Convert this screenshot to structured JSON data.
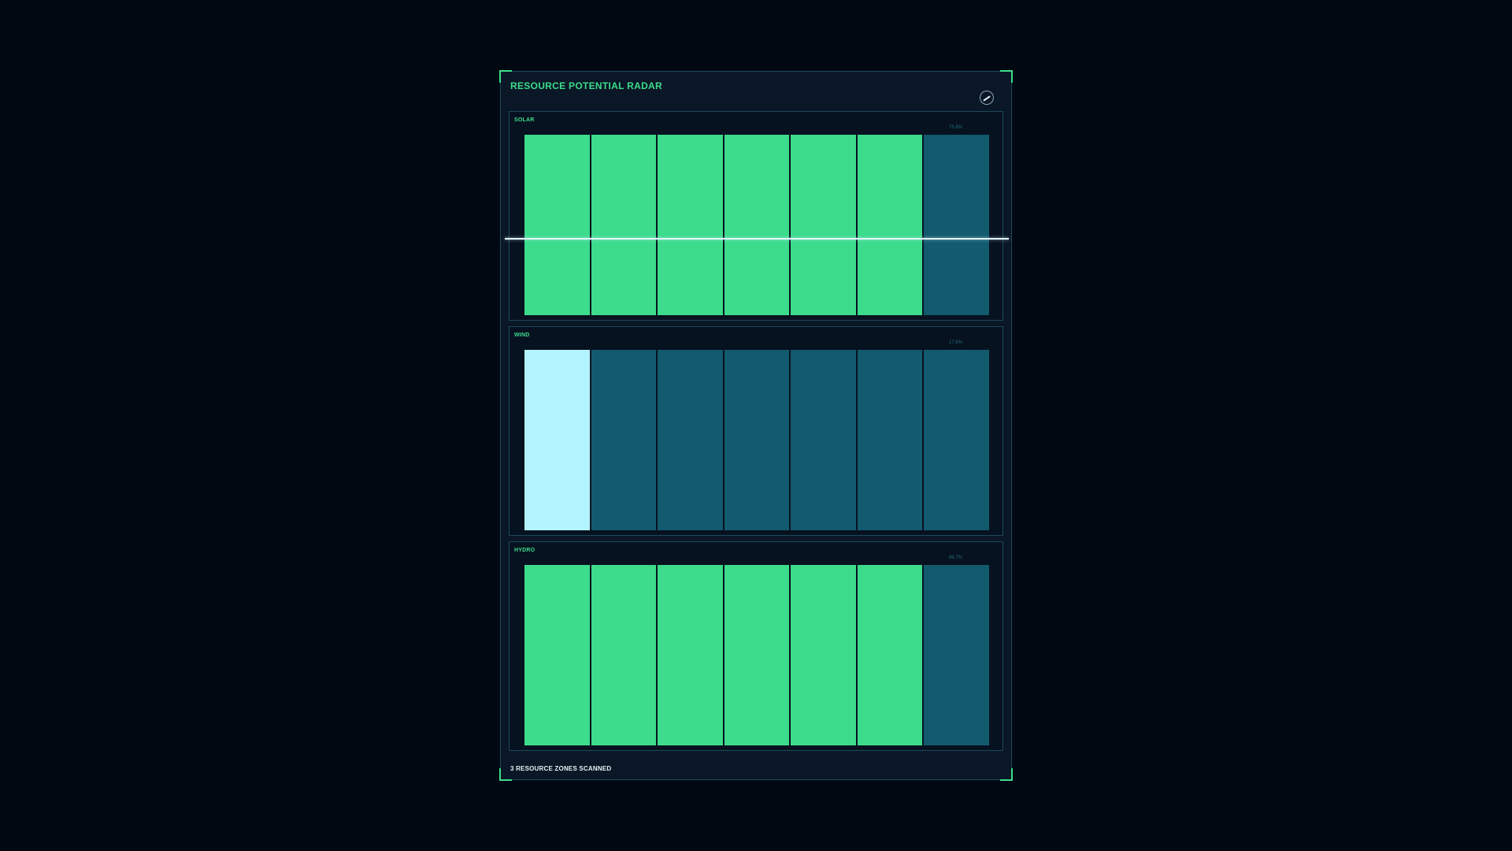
{
  "panel": {
    "title": "RESOURCE POTENTIAL RADAR",
    "footer": "3 RESOURCE ZONES SCANNED",
    "gauge_icon": "gauge-icon"
  },
  "colors": {
    "accent": "#3ddc8c",
    "active": "#3ddc8c",
    "inactive": "#125a6e",
    "highlight": "#b3f3ff"
  },
  "zones": [
    {
      "label": "SOLAR",
      "value": "75.8%",
      "bar_count": 7,
      "lit_count": 6,
      "lit_color": "#3ddc8c",
      "scanline": true
    },
    {
      "label": "WIND",
      "value": "17.8%",
      "bar_count": 7,
      "lit_count": 1,
      "lit_color": "#b3f3ff",
      "scanline": false
    },
    {
      "label": "HYDRO",
      "value": "86.7%",
      "bar_count": 7,
      "lit_count": 6,
      "lit_color": "#3ddc8c",
      "scanline": false
    }
  ]
}
